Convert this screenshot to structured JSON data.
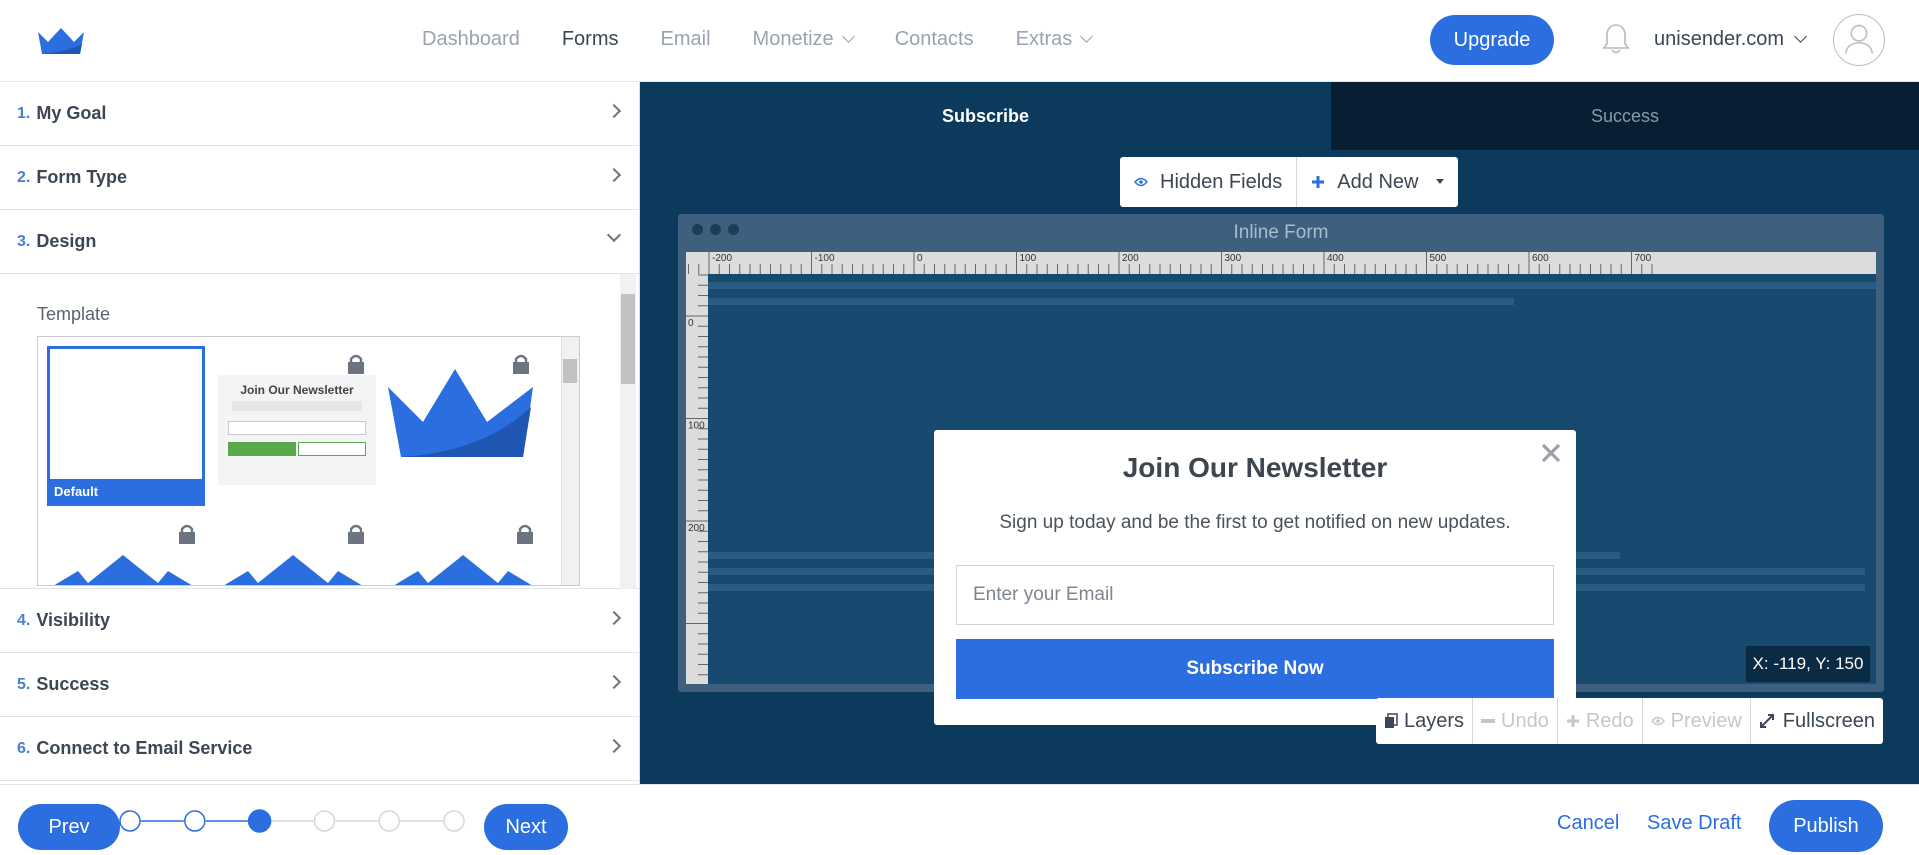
{
  "nav": {
    "items": [
      {
        "label": "Dashboard",
        "active": false,
        "dropdown": false
      },
      {
        "label": "Forms",
        "active": true,
        "dropdown": false
      },
      {
        "label": "Email",
        "active": false,
        "dropdown": false
      },
      {
        "label": "Monetize",
        "active": false,
        "dropdown": true
      },
      {
        "label": "Contacts",
        "active": false,
        "dropdown": false
      },
      {
        "label": "Extras",
        "active": false,
        "dropdown": true
      }
    ],
    "upgrade_label": "Upgrade",
    "account_label": "unisender.com"
  },
  "steps": {
    "s1": {
      "num": "1.",
      "label": "My Goal"
    },
    "s2": {
      "num": "2.",
      "label": "Form Type"
    },
    "s3": {
      "num": "3.",
      "label": "Design"
    },
    "s4": {
      "num": "4.",
      "label": "Visibility"
    },
    "s5": {
      "num": "5.",
      "label": "Success"
    },
    "s6": {
      "num": "6.",
      "label": "Connect to Email Service"
    }
  },
  "design": {
    "template_label": "Template",
    "selected_template": "Default",
    "thumb_title": "Join Our Newsletter"
  },
  "editor": {
    "tabs": [
      "Subscribe",
      "Success"
    ],
    "active_tab": "Subscribe",
    "hidden_fields_label": "Hidden Fields",
    "add_new_label": "Add New",
    "frame_title": "Inline Form",
    "ruler_top": [
      "-200",
      "-100",
      "0",
      "100",
      "200",
      "300",
      "400",
      "500",
      "600",
      "700"
    ],
    "ruler_left": [
      "0",
      "100",
      "200"
    ],
    "coords": "X: -119, Y: 150",
    "tools": {
      "layers": "Layers",
      "undo": "Undo",
      "redo": "Redo",
      "preview": "Preview",
      "fullscreen": "Fullscreen"
    }
  },
  "popup": {
    "title": "Join Our Newsletter",
    "subtitle": "Sign up today and be the first to get notified on new updates.",
    "email_placeholder": "Enter your Email",
    "button": "Subscribe Now"
  },
  "bottom": {
    "prev": "Prev",
    "next": "Next",
    "current_step": 3,
    "total_steps": 6,
    "cancel": "Cancel",
    "save_draft": "Save Draft",
    "publish": "Publish"
  },
  "colors": {
    "accent": "#2a6ee0",
    "editor_bg": "#0b3a5c",
    "stage_bg": "#174a6e"
  }
}
